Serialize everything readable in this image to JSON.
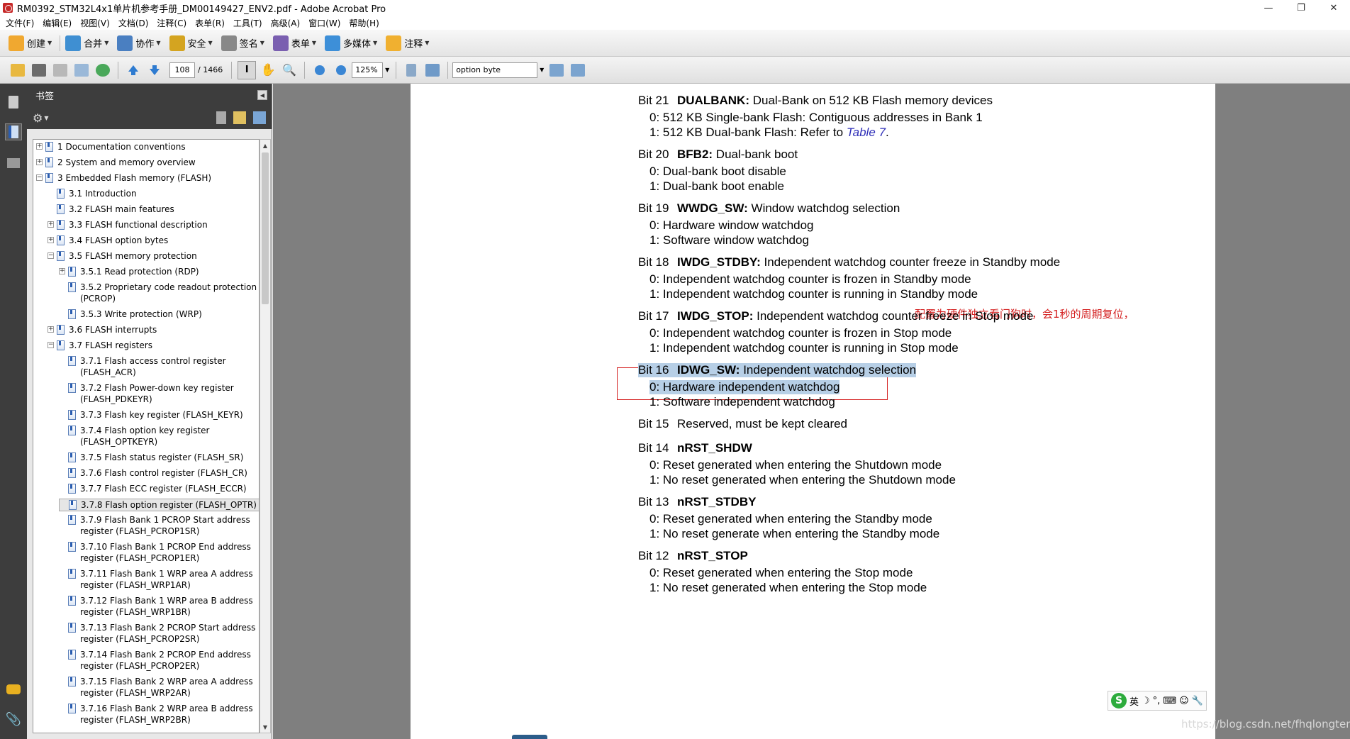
{
  "window": {
    "title": "RM0392_STM32L4x1单片机参考手册_DM00149427_ENV2.pdf - Adobe Acrobat Pro",
    "buttons": [
      "—",
      "❐",
      "✕"
    ]
  },
  "menu": [
    "文件(F)",
    "编辑(E)",
    "视图(V)",
    "文档(D)",
    "注释(C)",
    "表单(R)",
    "工具(T)",
    "高级(A)",
    "窗口(W)",
    "帮助(H)"
  ],
  "toolbar1": [
    {
      "label": "创建",
      "icon": "create-icon",
      "color": "#f0a830"
    },
    {
      "label": "合并",
      "icon": "combine-icon",
      "color": "#3f8fd2"
    },
    {
      "label": "协作",
      "icon": "collaborate-icon",
      "color": "#4a7fc1"
    },
    {
      "label": "安全",
      "icon": "lock-icon",
      "color": "#d4a420"
    },
    {
      "label": "签名",
      "icon": "pen-icon",
      "color": "#666666"
    },
    {
      "label": "表单",
      "icon": "form-icon",
      "color": "#7a5fb0"
    },
    {
      "label": "多媒体",
      "icon": "multimedia-icon",
      "color": "#3d8fd8"
    },
    {
      "label": "注释",
      "icon": "comment-icon",
      "color": "#f0b030"
    }
  ],
  "toolbar2": {
    "current_page": "108",
    "total_pages": "/ 1466",
    "zoom": "125%",
    "find_text": "option byte"
  },
  "bookmarks": {
    "title": "书签",
    "items": [
      {
        "label": "1 Documentation conventions",
        "level": 0,
        "expander": "+"
      },
      {
        "label": "2 System and memory overview",
        "level": 0,
        "expander": "+"
      },
      {
        "label": "3 Embedded Flash memory (FLASH)",
        "level": 0,
        "expander": "−"
      },
      {
        "label": "3.1 Introduction",
        "level": 1,
        "expander": ""
      },
      {
        "label": "3.2 FLASH main features",
        "level": 1,
        "expander": ""
      },
      {
        "label": "3.3 FLASH functional description",
        "level": 1,
        "expander": "+"
      },
      {
        "label": "3.4 FLASH option bytes",
        "level": 1,
        "expander": "+"
      },
      {
        "label": "3.5 FLASH memory protection",
        "level": 1,
        "expander": "−"
      },
      {
        "label": "3.5.1 Read protection (RDP)",
        "level": 2,
        "expander": "+"
      },
      {
        "label": "3.5.2 Proprietary code readout protection (PCROP)",
        "level": 2,
        "expander": ""
      },
      {
        "label": "3.5.3 Write protection (WRP)",
        "level": 2,
        "expander": ""
      },
      {
        "label": "3.6 FLASH interrupts",
        "level": 1,
        "expander": "+"
      },
      {
        "label": "3.7 FLASH registers",
        "level": 1,
        "expander": "−"
      },
      {
        "label": "3.7.1 Flash access control register (FLASH_ACR)",
        "level": 2,
        "expander": ""
      },
      {
        "label": "3.7.2 Flash Power-down key register (FLASH_PDKEYR)",
        "level": 2,
        "expander": ""
      },
      {
        "label": "3.7.3 Flash key register (FLASH_KEYR)",
        "level": 2,
        "expander": ""
      },
      {
        "label": "3.7.4 Flash option key register (FLASH_OPTKEYR)",
        "level": 2,
        "expander": ""
      },
      {
        "label": "3.7.5 Flash status register (FLASH_SR)",
        "level": 2,
        "expander": ""
      },
      {
        "label": "3.7.6 Flash control register (FLASH_CR)",
        "level": 2,
        "expander": ""
      },
      {
        "label": "3.7.7 Flash ECC register (FLASH_ECCR)",
        "level": 2,
        "expander": ""
      },
      {
        "label": "3.7.8 Flash option register (FLASH_OPTR)",
        "level": 2,
        "expander": "",
        "selected": true
      },
      {
        "label": "3.7.9 Flash Bank 1 PCROP Start address register (FLASH_PCROP1SR)",
        "level": 2,
        "expander": ""
      },
      {
        "label": "3.7.10 Flash Bank 1 PCROP End address register (FLASH_PCROP1ER)",
        "level": 2,
        "expander": ""
      },
      {
        "label": "3.7.11 Flash Bank 1 WRP area A address register (FLASH_WRP1AR)",
        "level": 2,
        "expander": ""
      },
      {
        "label": "3.7.12 Flash Bank 1 WRP area B address register (FLASH_WRP1BR)",
        "level": 2,
        "expander": ""
      },
      {
        "label": "3.7.13 Flash Bank 2 PCROP Start address register (FLASH_PCROP2SR)",
        "level": 2,
        "expander": ""
      },
      {
        "label": "3.7.14 Flash Bank 2 PCROP End address register (FLASH_PCROP2ER)",
        "level": 2,
        "expander": ""
      },
      {
        "label": "3.7.15 Flash Bank 2 WRP area A address register (FLASH_WRP2AR)",
        "level": 2,
        "expander": ""
      },
      {
        "label": "3.7.16 Flash Bank 2 WRP area B address register (FLASH_WRP2BR)",
        "level": 2,
        "expander": ""
      }
    ]
  },
  "document": {
    "lines": [
      {
        "kind": "bit",
        "bit": "Bit 21",
        "name": "DUALBANK:",
        "desc": " Dual-Bank on 512 KB Flash memory devices"
      },
      {
        "kind": "val",
        "text": "0: 512 KB Single-bank Flash: Contiguous addresses in Bank 1"
      },
      {
        "kind": "val",
        "text": "1: 512 KB Dual-bank Flash: Refer to ",
        "link": "Table 7",
        "tail": "."
      },
      {
        "kind": "bit",
        "bit": "Bit 20",
        "name": "BFB2:",
        "desc": " Dual-bank boot"
      },
      {
        "kind": "val",
        "text": "0: Dual-bank boot disable"
      },
      {
        "kind": "val",
        "text": "1: Dual-bank boot enable"
      },
      {
        "kind": "bit",
        "bit": "Bit 19",
        "name": "WWDG_SW:",
        "desc": " Window watchdog selection"
      },
      {
        "kind": "val",
        "text": "0: Hardware window watchdog"
      },
      {
        "kind": "val",
        "text": "1: Software window watchdog"
      },
      {
        "kind": "bit",
        "bit": "Bit 18",
        "name": "IWDG_STDBY:",
        "desc": " Independent watchdog counter freeze in Standby mode"
      },
      {
        "kind": "val",
        "text": "0: Independent watchdog counter is frozen in Standby mode"
      },
      {
        "kind": "val",
        "text": "1: Independent watchdog counter is running in Standby mode"
      },
      {
        "kind": "bit",
        "bit": "Bit 17",
        "name": "IWDG_STOP:",
        "desc": " Independent watchdog counter freeze in Stop mode"
      },
      {
        "kind": "val",
        "text": "0: Independent watchdog counter is frozen in Stop mode"
      },
      {
        "kind": "val",
        "text": "1: Independent watchdog counter is running in Stop mode"
      },
      {
        "kind": "bit",
        "bit": "Bit 16",
        "name": "IDWG_SW:",
        "desc": " Independent watchdog selection",
        "highlight": true
      },
      {
        "kind": "val",
        "text": "0: Hardware independent watchdog",
        "highlight": true
      },
      {
        "kind": "val",
        "text": "1: Software independent watchdog"
      },
      {
        "kind": "bit",
        "bit": "Bit 15",
        "name": "",
        "desc": "Reserved, must be kept cleared"
      },
      {
        "kind": "bit",
        "bit": "Bit 14",
        "name": "nRST_SHDW",
        "desc": ""
      },
      {
        "kind": "val",
        "text": "0: Reset generated when entering the Shutdown mode"
      },
      {
        "kind": "val",
        "text": "1: No reset generated when entering the Shutdown mode"
      },
      {
        "kind": "bit",
        "bit": "Bit 13",
        "name": "nRST_STDBY",
        "desc": ""
      },
      {
        "kind": "val",
        "text": "0: Reset generated when entering the Standby mode"
      },
      {
        "kind": "val",
        "text": "1: No reset generate when entering the Standby mode"
      },
      {
        "kind": "bit",
        "bit": "Bit 12",
        "name": "nRST_STOP",
        "desc": ""
      },
      {
        "kind": "val",
        "text": "0: Reset generated when entering the Stop mode"
      },
      {
        "kind": "val",
        "text": "1: No reset generated when entering the Stop mode"
      }
    ],
    "annotation": "配置为硬件独立看门狗时，会1秒的周期复位，"
  },
  "ime": {
    "logo": "S",
    "lang": "英",
    "icons": [
      "☽",
      "°,",
      "⌨",
      "☺",
      "🔧"
    ]
  },
  "watermark": "https://blog.csdn.net/fhqlongteng",
  "colors": {
    "highlight": "#b7cfe6",
    "annotation_red": "#d42020",
    "link_blue": "#2f2fb8"
  }
}
